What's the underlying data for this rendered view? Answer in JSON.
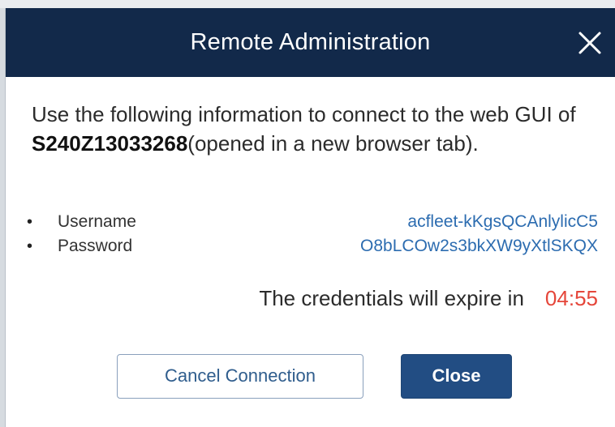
{
  "dialog": {
    "title": "Remote Administration",
    "intro_before": "Use the following information to connect to the web GUI of ",
    "device_id": "S240Z13033268",
    "intro_after": "(opened in a new browser tab).",
    "credentials": [
      {
        "label": "Username",
        "value": "acfleet-kKgsQCAnlylicC5"
      },
      {
        "label": "Password",
        "value": "O8bLCOw2s3bkXW9yXtlSKQX"
      }
    ],
    "expire_text": "The credentials will expire in",
    "expire_timer": "04:55",
    "buttons": {
      "cancel": "Cancel Connection",
      "close": "Close"
    }
  },
  "icons": {
    "close": "close-icon"
  },
  "colors": {
    "header_bg": "#12294a",
    "link_blue": "#2c6cb0",
    "timer_red": "#e5463a",
    "primary_button": "#224d83"
  }
}
